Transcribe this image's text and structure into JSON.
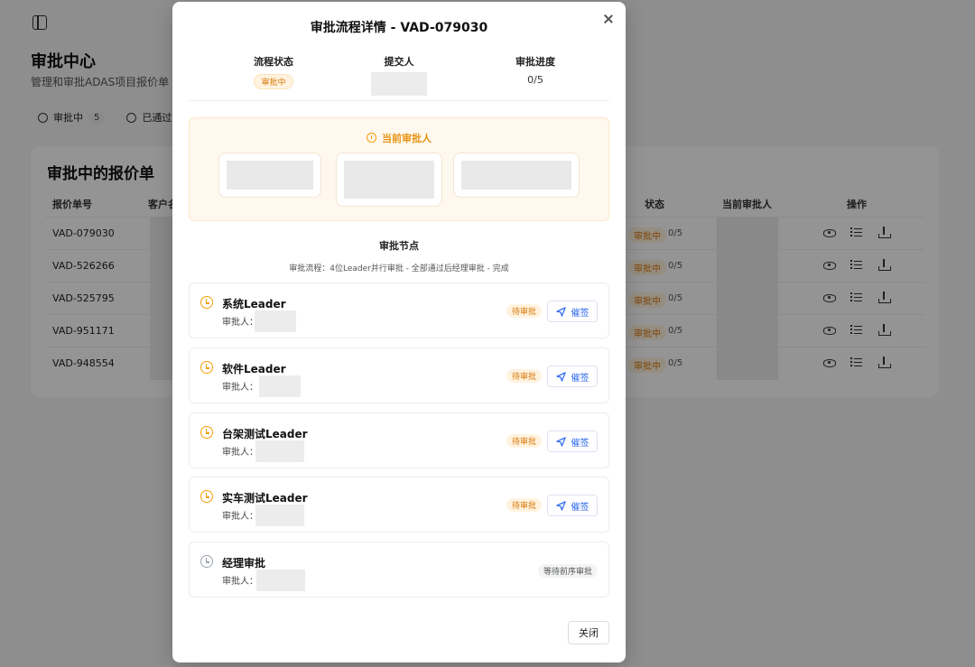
{
  "page": {
    "title": "审批中心",
    "subtitle": "管理和审批ADAS项目报价单",
    "filters": [
      {
        "label": "审批中",
        "count": "5"
      },
      {
        "label": "已通过"
      }
    ],
    "card_title": "审批中的报价单",
    "table": {
      "headers": {
        "id": "报价单号",
        "customer": "客户名",
        "status": "状态",
        "approver": "当前审批人",
        "actions": "操作"
      },
      "rows": [
        {
          "id": "VAD-079030",
          "status": "审批中",
          "progress": "0/5"
        },
        {
          "id": "VAD-526266",
          "status": "审批中",
          "progress": "0/5"
        },
        {
          "id": "VAD-525795",
          "status": "审批中",
          "progress": "0/5"
        },
        {
          "id": "VAD-951171",
          "status": "审批中",
          "progress": "0/5"
        },
        {
          "id": "VAD-948554",
          "status": "审批中",
          "progress": "0/5"
        }
      ]
    }
  },
  "modal": {
    "title": "审批流程详情 - VAD-079030",
    "summary": {
      "status_label": "流程状态",
      "status_value": "审批中",
      "submitter_label": "提交人",
      "progress_label": "审批进度",
      "progress_value": "0/5"
    },
    "current_approvers_title": "当前审批人",
    "nodes_title": "审批节点",
    "nodes_desc": "审批流程：4位Leader并行审批 - 全部通过后经理审批 - 完成",
    "approver_prefix": "审批人：",
    "nodes": [
      {
        "name": "系统Leader",
        "status": "待审批",
        "action": "催签"
      },
      {
        "name": "软件Leader",
        "status": "待审批",
        "action": "催签"
      },
      {
        "name": "台架测试Leader",
        "status": "待审批",
        "action": "催签"
      },
      {
        "name": "实车测试Leader",
        "status": "待审批",
        "action": "催签"
      },
      {
        "name": "经理审批",
        "status": "等待前序审批"
      }
    ],
    "close_label": "关闭"
  },
  "colors": {
    "accent_orange": "#f59e0b",
    "link_blue": "#2563eb",
    "overlay": "rgba(0,0,0,0.42)"
  }
}
